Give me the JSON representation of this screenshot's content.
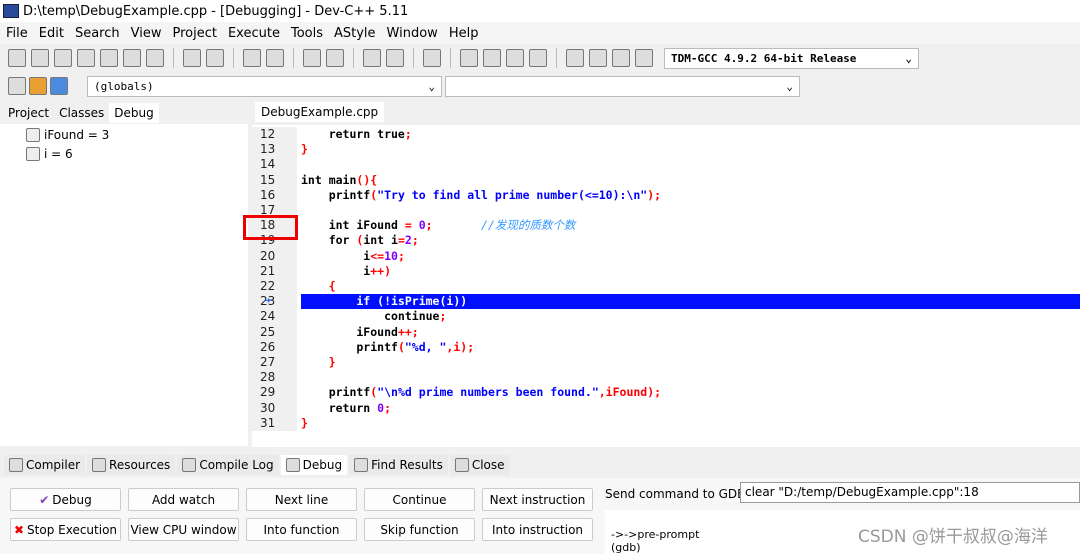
{
  "window": {
    "title": "D:\\temp\\DebugExample.cpp - [Debugging] - Dev-C++ 5.11"
  },
  "menu": [
    "File",
    "Edit",
    "Search",
    "View",
    "Project",
    "Execute",
    "Tools",
    "AStyle",
    "Window",
    "Help"
  ],
  "toolbar": {
    "compiler_select": "TDM-GCC 4.9.2 64-bit Release",
    "scope_select": "(globals)",
    "function_select": ""
  },
  "left_tabs": [
    "Project",
    "Classes",
    "Debug"
  ],
  "watches": [
    {
      "label": "iFound = 3"
    },
    {
      "label": "i = 6"
    }
  ],
  "editor_tab": "DebugExample.cpp",
  "colors": {
    "keyword": "#000000",
    "symbol": "#ff0000",
    "string": "#0000ff",
    "number": "#8000ff",
    "comment": "#3399ff",
    "current_line": "#0010ff",
    "breakpoint_marker": "#e00000"
  },
  "code": [
    {
      "n": "12",
      "tokens": [
        {
          "t": "    return true",
          "c": "keyword"
        },
        {
          "t": ";",
          "c": "symbol"
        }
      ]
    },
    {
      "n": "13",
      "tokens": [
        {
          "t": "}",
          "c": "symbol"
        }
      ]
    },
    {
      "n": "14",
      "tokens": []
    },
    {
      "n": "15",
      "tokens": [
        {
          "t": "int main",
          "c": "keyword"
        },
        {
          "t": "(){",
          "c": "symbol"
        }
      ]
    },
    {
      "n": "16",
      "tokens": [
        {
          "t": "    printf",
          "c": "keyword"
        },
        {
          "t": "(",
          "c": "symbol"
        },
        {
          "t": "\"Try to find all prime number(<=10):\\n\"",
          "c": "string"
        },
        {
          "t": ");",
          "c": "symbol"
        }
      ]
    },
    {
      "n": "17",
      "tokens": []
    },
    {
      "n": "18",
      "tokens": [
        {
          "t": "    int iFound ",
          "c": "keyword"
        },
        {
          "t": "= ",
          "c": "symbol"
        },
        {
          "t": "0",
          "c": "number"
        },
        {
          "t": ";",
          "c": "symbol"
        },
        {
          "t": "       //发现的质数个数",
          "c": "comment"
        }
      ]
    },
    {
      "n": "19",
      "tokens": [
        {
          "t": "    for ",
          "c": "keyword"
        },
        {
          "t": "(",
          "c": "symbol"
        },
        {
          "t": "int i",
          "c": "keyword"
        },
        {
          "t": "=",
          "c": "symbol"
        },
        {
          "t": "2",
          "c": "number"
        },
        {
          "t": ";",
          "c": "symbol"
        }
      ]
    },
    {
      "n": "20",
      "tokens": [
        {
          "t": "         i",
          "c": "keyword"
        },
        {
          "t": "<=",
          "c": "symbol"
        },
        {
          "t": "10",
          "c": "number"
        },
        {
          "t": ";",
          "c": "symbol"
        }
      ]
    },
    {
      "n": "21",
      "tokens": [
        {
          "t": "         i",
          "c": "keyword"
        },
        {
          "t": "++)",
          "c": "symbol"
        }
      ]
    },
    {
      "n": "22",
      "tokens": [
        {
          "t": "    {",
          "c": "symbol"
        }
      ]
    },
    {
      "n": "23",
      "tokens": [
        {
          "t": "        if (!isPrime(i))",
          "c": "keyword"
        }
      ],
      "current": true
    },
    {
      "n": "24",
      "tokens": [
        {
          "t": "            continue",
          "c": "keyword"
        },
        {
          "t": ";",
          "c": "symbol"
        }
      ]
    },
    {
      "n": "25",
      "tokens": [
        {
          "t": "        iFound",
          "c": "keyword"
        },
        {
          "t": "++;",
          "c": "symbol"
        }
      ]
    },
    {
      "n": "26",
      "tokens": [
        {
          "t": "        printf",
          "c": "keyword"
        },
        {
          "t": "(",
          "c": "symbol"
        },
        {
          "t": "\"%d, \"",
          "c": "string"
        },
        {
          "t": ",i);",
          "c": "symbol"
        }
      ]
    },
    {
      "n": "27",
      "tokens": [
        {
          "t": "    }",
          "c": "symbol"
        }
      ]
    },
    {
      "n": "28",
      "tokens": []
    },
    {
      "n": "29",
      "tokens": [
        {
          "t": "    printf",
          "c": "keyword"
        },
        {
          "t": "(",
          "c": "symbol"
        },
        {
          "t": "\"\\n%d prime numbers been found.\"",
          "c": "string"
        },
        {
          "t": ",iFound);",
          "c": "symbol"
        }
      ]
    },
    {
      "n": "30",
      "tokens": [
        {
          "t": "    return ",
          "c": "keyword"
        },
        {
          "t": "0",
          "c": "number"
        },
        {
          "t": ";",
          "c": "symbol"
        }
      ]
    },
    {
      "n": "31",
      "tokens": [
        {
          "t": "}",
          "c": "symbol"
        }
      ]
    }
  ],
  "bottom_tabs": [
    "Compiler",
    "Resources",
    "Compile Log",
    "Debug",
    "Find Results",
    "Close"
  ],
  "debug_buttons": [
    "Debug",
    "Add watch",
    "Next line",
    "Continue",
    "Next instruction",
    "Stop Execution",
    "View CPU window",
    "Into function",
    "Skip function",
    "Into instruction"
  ],
  "gdb": {
    "label": "Send command to GDB:",
    "value": "clear \"D:/temp/DebugExample.cpp\":18",
    "output": [
      "->->pre-prompt",
      "(gdb)"
    ]
  },
  "watermark": "CSDN @饼干叔叔@海洋"
}
